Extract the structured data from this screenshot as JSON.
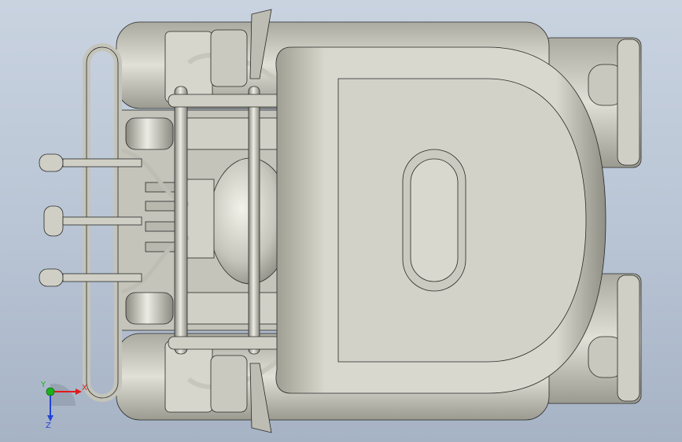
{
  "viewport": {
    "background_top": "#c9d3e0",
    "background_bottom": "#a6b3c5"
  },
  "model": {
    "body_color": "#d3d3c8",
    "body_shade": "#a9a99e",
    "edge_color": "#2a2a2a",
    "metal_color": "#c8c8be"
  },
  "triad": {
    "x_label": "X",
    "y_label": "Y",
    "z_label": "Z",
    "x_color": "#e01b1b",
    "y_color": "#1bb11b",
    "z_color": "#2344d6"
  }
}
